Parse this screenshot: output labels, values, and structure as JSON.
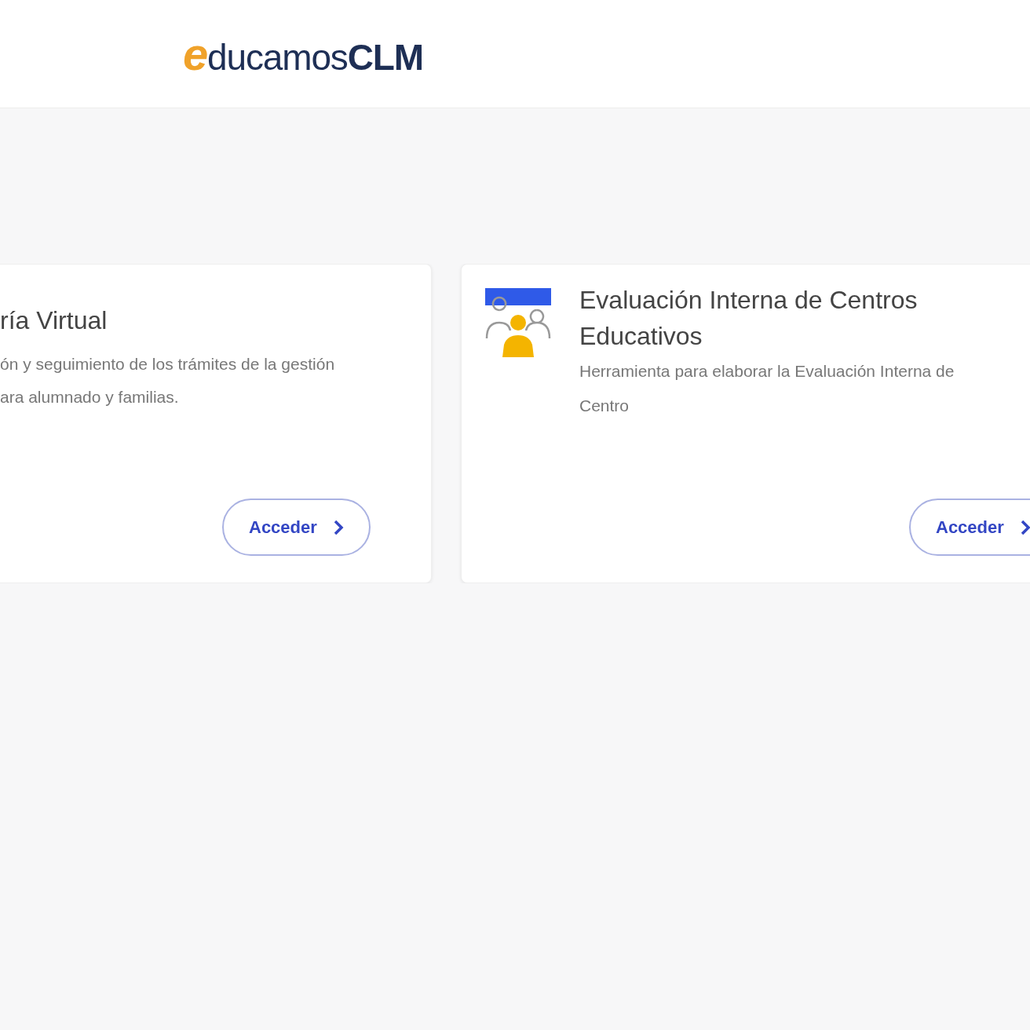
{
  "header": {
    "logo": {
      "mark": "e",
      "text": "ducamos",
      "suffix": "CLM"
    }
  },
  "cards": [
    {
      "kind": "plain",
      "title": "ría Virtual",
      "description_lines": [
        "ón y seguimiento de los trámites de la gestión",
        "ara alumnado y familias."
      ],
      "button": "Acceder"
    },
    {
      "kind": "icon",
      "title": "Evaluación Interna de Centros Educativos",
      "description_lines": [
        "Herramienta para elaborar la Evaluación Interna de",
        "Centro"
      ],
      "button": "Acceder"
    }
  ]
}
